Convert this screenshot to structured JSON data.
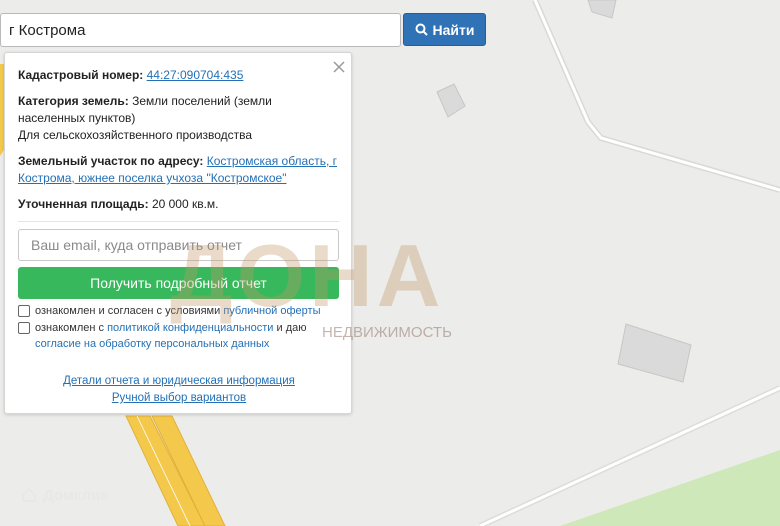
{
  "search": {
    "value": "г Кострома",
    "button_label": "Найти"
  },
  "card": {
    "cadastral_label": "Кадастровый номер:",
    "cadastral_value": "44:27:090704:435",
    "category_label": "Категория земель:",
    "category_value": "Земли поселений (земли населенных пунктов)",
    "usage_value": "Для сельскохозяйственного производства",
    "address_label": "Земельный участок по адресу:",
    "address_value": "Костромская область, г Кострома, южнее поселка учхоза \"Костромское\"",
    "area_label": "Уточненная площадь:",
    "area_value": "20 000 кв.м.",
    "email_placeholder": "Ваш email, куда отправить отчет",
    "get_button": "Получить подробный отчет",
    "agree1_text": "ознакомлен и согласен с условиями ",
    "agree1_link": "публичной оферты",
    "agree2_text": "ознакомлен с ",
    "agree2_link": "политикой конфиденциальности",
    "agree2_mid": " и даю",
    "agree2_link2": "согласие на обработку персональных данных",
    "details_link": "Детали отчета и юридическая информация",
    "manual_link": "Ручной выбор вариантов"
  },
  "watermark": {
    "brand": "ДОНА",
    "sub": "НЕДВИЖИМОСТЬ"
  },
  "footer_logo": "Домклик",
  "colors": {
    "search_button": "#2f72b6",
    "get_button": "#38b85c",
    "link": "#2370b6"
  }
}
